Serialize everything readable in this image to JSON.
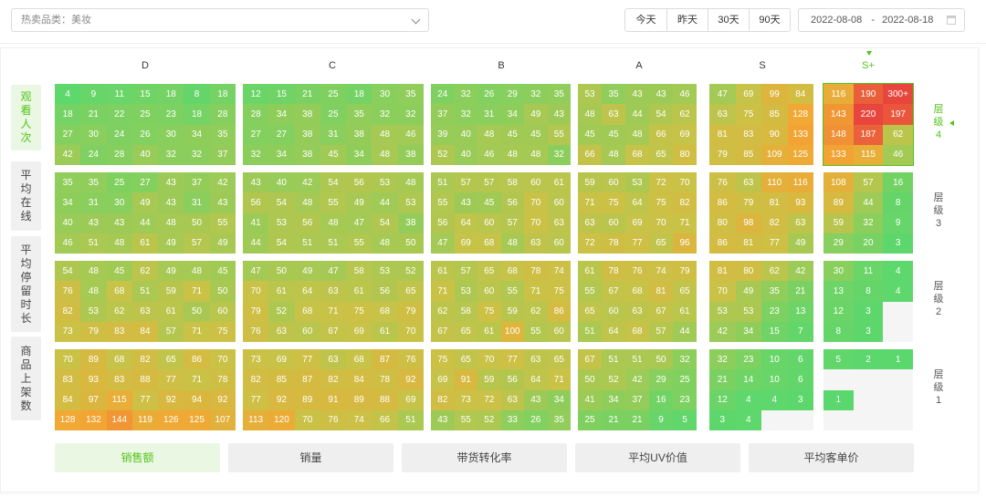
{
  "header": {
    "category_filter": "热卖品类：美妆",
    "range_buttons": [
      "今天",
      "昨天",
      "30天",
      "90天"
    ],
    "date_start": "2022-08-08",
    "date_separator": "-",
    "date_end": "2022-08-18"
  },
  "columns": [
    "D",
    "C",
    "B",
    "A",
    "S",
    "S+"
  ],
  "active_column": "S+",
  "metrics_tabs": [
    {
      "label": "观看人次",
      "chars": [
        "观",
        "看",
        "人",
        "次"
      ]
    },
    {
      "label": "平均在线",
      "chars": [
        "平",
        "均",
        "在",
        "线"
      ]
    },
    {
      "label": "平均停留时长",
      "chars": [
        "平",
        "均",
        "停",
        "留",
        "时",
        "长"
      ]
    },
    {
      "label": "商品上架数",
      "chars": [
        "商",
        "品",
        "上",
        "架",
        "数"
      ]
    }
  ],
  "active_metric_tab": 0,
  "tiers": [
    {
      "label": "层级4",
      "chars": [
        "层",
        "级",
        "4"
      ]
    },
    {
      "label": "层级3",
      "chars": [
        "层",
        "级",
        "3"
      ]
    },
    {
      "label": "层级2",
      "chars": [
        "层",
        "级",
        "2"
      ]
    },
    {
      "label": "层级1",
      "chars": [
        "层",
        "级",
        "1"
      ]
    }
  ],
  "active_tier": 0,
  "bottom_tabs": [
    "销售额",
    "销量",
    "带货转化率",
    "平均UV价值",
    "平均客单价"
  ],
  "active_bottom_tab": 0,
  "colors": {
    "accent": "#52c41a",
    "low": "#58d86e",
    "mid": "#c9c247",
    "high": "#f2a733",
    "max": "#e8453c"
  },
  "heatmap": {
    "rows": [
      [
        [
          [
            "4",
            "9",
            "11",
            "15",
            "18",
            "8",
            "18"
          ],
          [
            "18",
            "21",
            "22",
            "25",
            "23",
            "18",
            "28"
          ],
          [
            "27",
            "30",
            "24",
            "26",
            "30",
            "34",
            "35"
          ],
          [
            "42",
            "24",
            "28",
            "40",
            "32",
            "32",
            "37"
          ]
        ],
        [
          [
            "12",
            "15",
            "21",
            "25",
            "18",
            "30",
            "35"
          ],
          [
            "28",
            "34",
            "38",
            "25",
            "35",
            "32",
            "32"
          ],
          [
            "27",
            "27",
            "38",
            "31",
            "38",
            "48",
            "46"
          ],
          [
            "32",
            "34",
            "38",
            "45",
            "34",
            "48",
            "38"
          ]
        ],
        [
          [
            "24",
            "32",
            "26",
            "29",
            "32",
            "35"
          ],
          [
            "37",
            "32",
            "31",
            "34",
            "49",
            "43"
          ],
          [
            "39",
            "40",
            "48",
            "45",
            "45",
            "55"
          ],
          [
            "52",
            "40",
            "46",
            "48",
            "48",
            "32"
          ]
        ],
        [
          [
            "53",
            "35",
            "43",
            "43",
            "46"
          ],
          [
            "48",
            "63",
            "44",
            "54",
            "62"
          ],
          [
            "45",
            "45",
            "48",
            "66",
            "69"
          ],
          [
            "66",
            "48",
            "68",
            "65",
            "80"
          ]
        ],
        [
          [
            "47",
            "69",
            "99",
            "84"
          ],
          [
            "63",
            "75",
            "85",
            "128"
          ],
          [
            "81",
            "83",
            "90",
            "133"
          ],
          [
            "79",
            "85",
            "109",
            "125"
          ]
        ],
        [
          [
            "116",
            "190",
            "300+"
          ],
          [
            "143",
            "220",
            "197"
          ],
          [
            "148",
            "187",
            "62"
          ],
          [
            "133",
            "115",
            "46"
          ]
        ]
      ],
      [
        [
          [
            "35",
            "35",
            "25",
            "27",
            "43",
            "37",
            "42"
          ],
          [
            "34",
            "31",
            "30",
            "49",
            "43",
            "31",
            "43"
          ],
          [
            "40",
            "43",
            "43",
            "44",
            "48",
            "50",
            "55"
          ],
          [
            "46",
            "51",
            "48",
            "61",
            "49",
            "57",
            "49"
          ]
        ],
        [
          [
            "43",
            "40",
            "42",
            "54",
            "56",
            "53",
            "48"
          ],
          [
            "56",
            "54",
            "48",
            "55",
            "49",
            "44",
            "53"
          ],
          [
            "41",
            "53",
            "56",
            "48",
            "47",
            "54",
            "38"
          ],
          [
            "44",
            "54",
            "51",
            "51",
            "55",
            "48",
            "50"
          ]
        ],
        [
          [
            "51",
            "57",
            "57",
            "58",
            "60",
            "61"
          ],
          [
            "55",
            "43",
            "45",
            "56",
            "70",
            "60"
          ],
          [
            "56",
            "64",
            "60",
            "57",
            "70",
            "63"
          ],
          [
            "47",
            "69",
            "68",
            "48",
            "63",
            "60"
          ]
        ],
        [
          [
            "59",
            "60",
            "53",
            "72",
            "70"
          ],
          [
            "71",
            "75",
            "64",
            "75",
            "82"
          ],
          [
            "63",
            "60",
            "69",
            "70",
            "71"
          ],
          [
            "72",
            "78",
            "77",
            "65",
            "96"
          ]
        ],
        [
          [
            "76",
            "63",
            "110",
            "116"
          ],
          [
            "86",
            "79",
            "81",
            "93"
          ],
          [
            "80",
            "98",
            "82",
            "63"
          ],
          [
            "86",
            "81",
            "77",
            "49"
          ]
        ],
        [
          [
            "108",
            "57",
            "16"
          ],
          [
            "89",
            "44",
            "8"
          ],
          [
            "59",
            "32",
            "9"
          ],
          [
            "29",
            "20",
            "3"
          ]
        ]
      ],
      [
        [
          [
            "54",
            "48",
            "45",
            "62",
            "49",
            "48",
            "45"
          ],
          [
            "76",
            "48",
            "68",
            "51",
            "59",
            "71",
            "50"
          ],
          [
            "82",
            "53",
            "62",
            "63",
            "61",
            "50",
            "60"
          ],
          [
            "73",
            "79",
            "83",
            "84",
            "57",
            "71",
            "75"
          ]
        ],
        [
          [
            "47",
            "50",
            "49",
            "47",
            "58",
            "53",
            "52"
          ],
          [
            "70",
            "61",
            "64",
            "63",
            "61",
            "56",
            "65"
          ],
          [
            "79",
            "52",
            "68",
            "71",
            "75",
            "68",
            "79"
          ],
          [
            "76",
            "63",
            "60",
            "67",
            "69",
            "61",
            "70"
          ]
        ],
        [
          [
            "61",
            "57",
            "65",
            "68",
            "78",
            "74"
          ],
          [
            "71",
            "53",
            "60",
            "55",
            "71",
            "75"
          ],
          [
            "62",
            "58",
            "75",
            "59",
            "62",
            "86"
          ],
          [
            "67",
            "65",
            "61",
            "100",
            "55",
            "60"
          ]
        ],
        [
          [
            "61",
            "78",
            "76",
            "74",
            "79"
          ],
          [
            "55",
            "67",
            "68",
            "81",
            "65"
          ],
          [
            "65",
            "60",
            "63",
            "67",
            "61"
          ],
          [
            "51",
            "64",
            "68",
            "57",
            "44"
          ]
        ],
        [
          [
            "81",
            "80",
            "62",
            "42"
          ],
          [
            "70",
            "49",
            "35",
            "21"
          ],
          [
            "53",
            "53",
            "23",
            "13"
          ],
          [
            "42",
            "34",
            "15",
            "7"
          ]
        ],
        [
          [
            "30",
            "11",
            "4"
          ],
          [
            "13",
            "8",
            "4"
          ],
          [
            "12",
            "3",
            ""
          ],
          [
            "8",
            "3",
            ""
          ]
        ]
      ],
      [
        [
          [
            "70",
            "89",
            "68",
            "82",
            "65",
            "86",
            "70"
          ],
          [
            "83",
            "93",
            "83",
            "88",
            "77",
            "71",
            "78"
          ],
          [
            "84",
            "97",
            "115",
            "77",
            "92",
            "94",
            "92"
          ],
          [
            "128",
            "132",
            "144",
            "119",
            "126",
            "125",
            "107"
          ]
        ],
        [
          [
            "73",
            "69",
            "77",
            "63",
            "68",
            "87",
            "76"
          ],
          [
            "82",
            "85",
            "87",
            "82",
            "84",
            "78",
            "92"
          ],
          [
            "77",
            "92",
            "89",
            "91",
            "89",
            "88",
            "69"
          ],
          [
            "113",
            "120",
            "70",
            "76",
            "74",
            "66",
            "51"
          ]
        ],
        [
          [
            "75",
            "65",
            "70",
            "77",
            "63",
            "65"
          ],
          [
            "69",
            "91",
            "59",
            "56",
            "64",
            "71"
          ],
          [
            "82",
            "73",
            "72",
            "63",
            "43",
            "34"
          ],
          [
            "43",
            "55",
            "52",
            "33",
            "26",
            "35"
          ]
        ],
        [
          [
            "67",
            "51",
            "51",
            "50",
            "32"
          ],
          [
            "50",
            "52",
            "42",
            "29",
            "25"
          ],
          [
            "41",
            "34",
            "37",
            "16",
            "23"
          ],
          [
            "25",
            "21",
            "21",
            "9",
            "5"
          ]
        ],
        [
          [
            "32",
            "23",
            "10",
            "6"
          ],
          [
            "21",
            "14",
            "10",
            "6"
          ],
          [
            "12",
            "4",
            "4",
            "3"
          ],
          [
            "3",
            "4",
            "",
            ""
          ]
        ],
        [
          [
            "5",
            "2",
            "1"
          ],
          [
            "",
            "",
            ""
          ],
          [
            "1",
            "",
            ""
          ],
          [
            "",
            "",
            ""
          ]
        ]
      ]
    ]
  }
}
